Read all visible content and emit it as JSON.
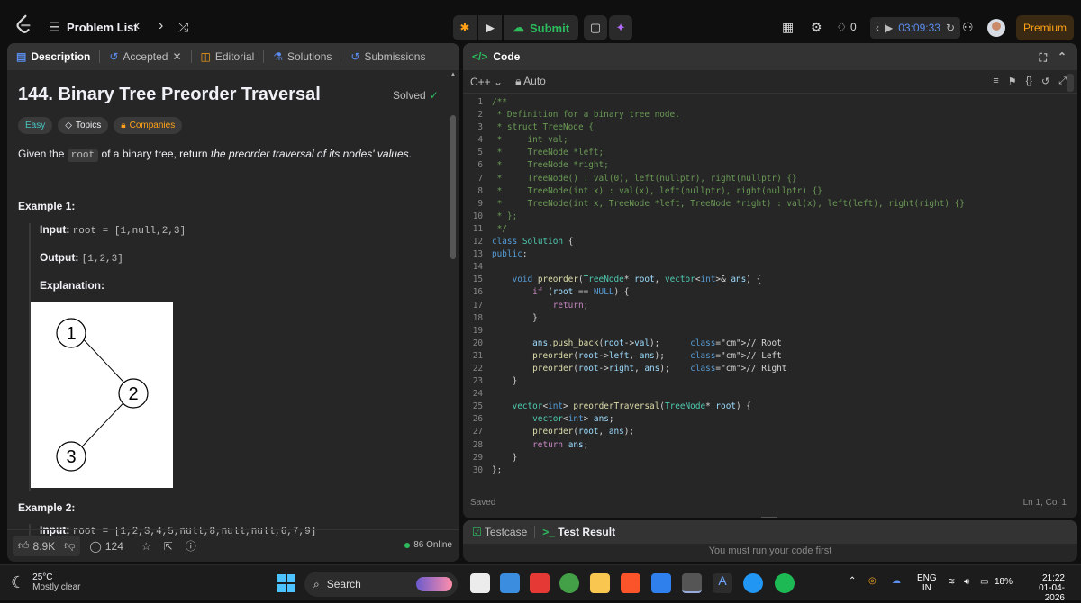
{
  "topbar": {
    "problem_list": "Problem List",
    "submit_label": "Submit",
    "streak": "0",
    "timer": "03:09:33",
    "premium": "Premium"
  },
  "left": {
    "tabs": [
      "Description",
      "Accepted",
      "Editorial",
      "Solutions",
      "Submissions"
    ],
    "title": "144. Binary Tree Preorder Traversal",
    "solved": "Solved",
    "tags": [
      "Easy",
      "Topics",
      "Companies"
    ],
    "desc_prefix": "Given the",
    "desc_code": "root",
    "desc_mid": "of a binary tree, return",
    "desc_italic": "the preorder traversal of its nodes' values",
    "desc_end": ".",
    "example1_head": "Example 1:",
    "input_label": "Input:",
    "input_value": "root = [1,null,2,3]",
    "output_label": "Output:",
    "output_value": "[1,2,3]",
    "explanation_label": "Explanation:",
    "tree_nodes": [
      "1",
      "2",
      "3"
    ],
    "example2_head": "Example 2:",
    "example2_input_label": "Input:",
    "example2_input_value": "root = [1,2,3,4,5,null,8,null,null,6,7,9]",
    "likes": "8.9K",
    "comments": "124",
    "online": "86 Online"
  },
  "code": {
    "header": "Code",
    "language": "C++",
    "mode": "Auto",
    "status": "Saved",
    "cursor": "Ln 1, Col 1",
    "lines": [
      "/**",
      " * Definition for a binary tree node.",
      " * struct TreeNode {",
      " *     int val;",
      " *     TreeNode *left;",
      " *     TreeNode *right;",
      " *     TreeNode() : val(0), left(nullptr), right(nullptr) {}",
      " *     TreeNode(int x) : val(x), left(nullptr), right(nullptr) {}",
      " *     TreeNode(int x, TreeNode *left, TreeNode *right) : val(x), left(left), right(right) {}",
      " * };",
      " */",
      "class Solution {",
      "public:",
      "",
      "    void preorder(TreeNode* root, vector<int>& ans) {",
      "        if (root == NULL) {",
      "            return;",
      "        }",
      "",
      "        ans.push_back(root->val);      // Root",
      "        preorder(root->left, ans);     // Left",
      "        preorder(root->right, ans);    // Right",
      "    }",
      "",
      "    vector<int> preorderTraversal(TreeNode* root) {",
      "        vector<int> ans;",
      "        preorder(root, ans);",
      "        return ans;",
      "    }",
      "};"
    ]
  },
  "bottom": {
    "tab_testcase": "Testcase",
    "tab_result": "Test Result",
    "message": "You must run your code first"
  },
  "taskbar": {
    "temp": "25°C",
    "weather": "Mostly clear",
    "search": "Search",
    "lang1": "ENG",
    "lang2": "IN",
    "battery": "18%",
    "time": "21:22",
    "date": "01-04-2026"
  },
  "colors": {
    "accent_orange": "#ffa116",
    "green": "#2cbb5d",
    "easy_teal": "#46c6c2",
    "panel_bg": "#262626"
  }
}
